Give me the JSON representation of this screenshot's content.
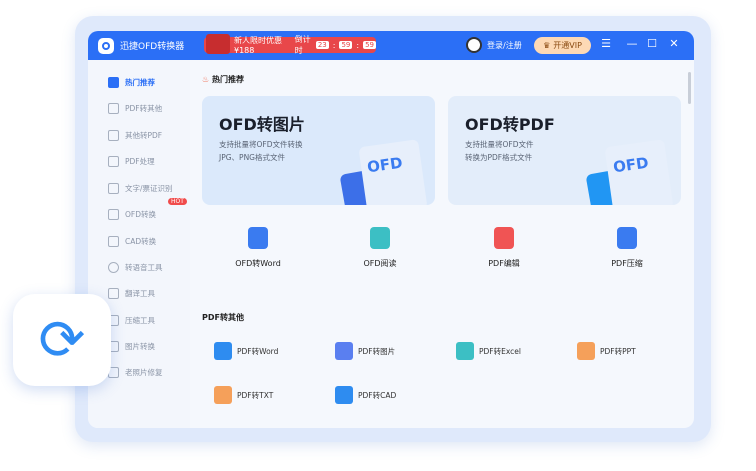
{
  "titlebar": {
    "app_title": "迅捷OFD转换器",
    "promo_text": "新人限时优惠 ¥188",
    "countdown_label": "倒计时",
    "countdown": [
      "23",
      "59",
      "59"
    ],
    "login": "登录/注册",
    "vip": "开通VIP",
    "menu": "☰",
    "minimize": "—",
    "maximize": "☐",
    "close": "✕"
  },
  "sidebar": {
    "items": [
      {
        "label": "热门推荐"
      },
      {
        "label": "PDF转其他"
      },
      {
        "label": "其他转PDF"
      },
      {
        "label": "PDF处理"
      },
      {
        "label": "文字/票证识别"
      },
      {
        "label": "OFD转换",
        "badge": "HOT"
      },
      {
        "label": "CAD转换"
      },
      {
        "label": "转语音工具"
      },
      {
        "label": "翻译工具"
      },
      {
        "label": "压缩工具"
      },
      {
        "label": "图片转换"
      },
      {
        "label": "老照片修复"
      }
    ]
  },
  "main": {
    "hot_section": "热门推荐",
    "cards": [
      {
        "title": "OFD转图片",
        "desc1": "支持批量将OFD文件转换",
        "desc2": "JPG、PNG格式文件",
        "badge": "OFD"
      },
      {
        "title": "OFD转PDF",
        "desc1": "支持批量将OFD文件",
        "desc2": "转换为PDF格式文件",
        "badge": "OFD"
      }
    ],
    "tools": [
      {
        "label": "OFD转Word",
        "color": "#3a7bf0"
      },
      {
        "label": "OFD阅读",
        "color": "#3cbfc4"
      },
      {
        "label": "PDF编辑",
        "color": "#f05454"
      },
      {
        "label": "PDF压缩",
        "color": "#3a7bf0"
      }
    ],
    "pdf_section": "PDF转其他",
    "pdf_items": [
      {
        "label": "PDF转Word",
        "color": "#2e8cf0"
      },
      {
        "label": "PDF转图片",
        "color": "#5a7ff0"
      },
      {
        "label": "PDF转Excel",
        "color": "#3cbfc4"
      },
      {
        "label": "PDF转PPT",
        "color": "#f5a05a"
      },
      {
        "label": "PDF转TXT",
        "color": "#f5a05a"
      },
      {
        "label": "PDF转CAD",
        "color": "#2e8cf0"
      }
    ]
  },
  "refresh_icon": "⟳"
}
